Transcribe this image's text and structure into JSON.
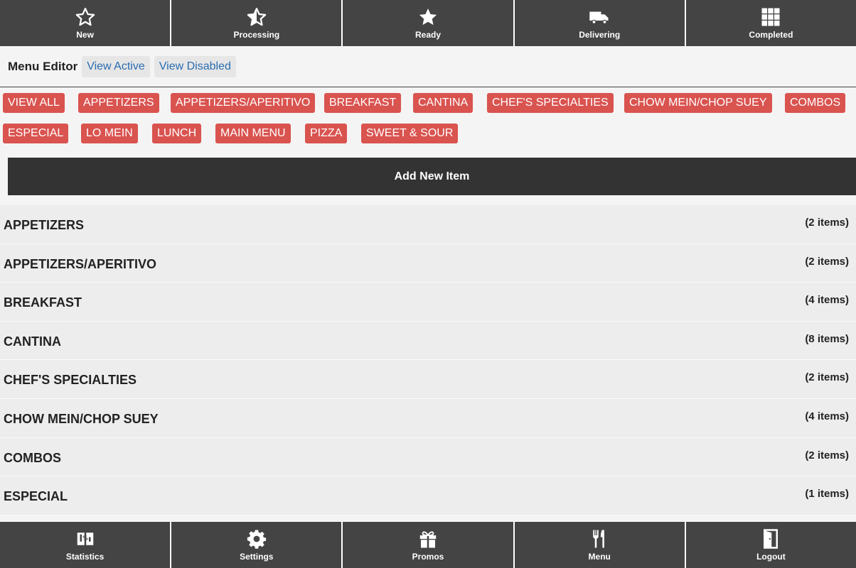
{
  "top_nav": [
    {
      "name": "new",
      "label": "New",
      "icon": "star-outline-icon"
    },
    {
      "name": "processing",
      "label": "Processing",
      "icon": "star-half-icon"
    },
    {
      "name": "ready",
      "label": "Ready",
      "icon": "star-filled-icon"
    },
    {
      "name": "delivering",
      "label": "Delivering",
      "icon": "truck-icon"
    },
    {
      "name": "completed",
      "label": "Completed",
      "icon": "grid-icon"
    }
  ],
  "editor": {
    "title": "Menu Editor",
    "view_active": "View Active",
    "view_disabled": "View Disabled"
  },
  "chips": [
    "VIEW ALL",
    "APPETIZERS",
    "APPETIZERS/APERITIVO",
    "BREAKFAST",
    "CANTINA",
    "CHEF'S SPECIALTIES",
    "CHOW MEIN/CHOP SUEY",
    "COMBOS",
    "ESPECIAL",
    "LO MEIN",
    "LUNCH",
    "MAIN MENU",
    "PIZZA",
    "SWEET & SOUR"
  ],
  "add_button": "Add New Item",
  "categories": [
    {
      "name": "APPETIZERS",
      "count": "(2 items)"
    },
    {
      "name": "APPETIZERS/APERITIVO",
      "count": "(2 items)"
    },
    {
      "name": "BREAKFAST",
      "count": "(4 items)"
    },
    {
      "name": "CANTINA",
      "count": "(8 items)"
    },
    {
      "name": "CHEF'S SPECIALTIES",
      "count": "(2 items)"
    },
    {
      "name": "CHOW MEIN/CHOP SUEY",
      "count": "(4 items)"
    },
    {
      "name": "COMBOS",
      "count": "(2 items)"
    },
    {
      "name": "ESPECIAL",
      "count": "(1 items)"
    }
  ],
  "bottom_nav": [
    {
      "name": "statistics",
      "label": "Statistics",
      "icon": "statistics-icon"
    },
    {
      "name": "settings",
      "label": "Settings",
      "icon": "gear-icon"
    },
    {
      "name": "promos",
      "label": "Promos",
      "icon": "gift-icon"
    },
    {
      "name": "menu",
      "label": "Menu",
      "icon": "fork-knife-icon"
    },
    {
      "name": "logout",
      "label": "Logout",
      "icon": "door-icon"
    }
  ],
  "colors": {
    "nav_bg": "#444444",
    "chip_bg": "#d9534f",
    "add_bg": "#333333",
    "row_bg": "#ededed",
    "link": "#2a6db0"
  }
}
